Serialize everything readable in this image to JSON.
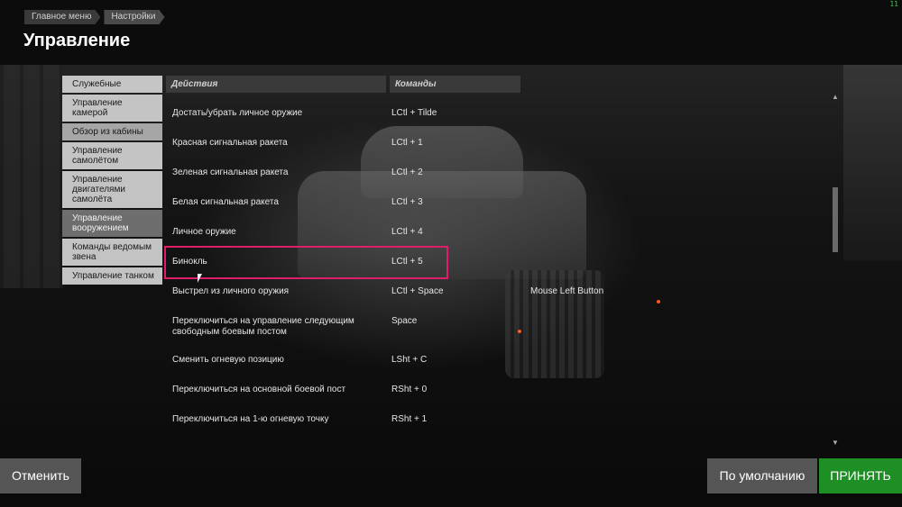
{
  "fps": "11",
  "breadcrumb": [
    "Главное меню",
    "Настройки"
  ],
  "title": "Управление",
  "sidebar": {
    "items": [
      "Служебные",
      "Управление камерой",
      "Обзор из кабины",
      "Управление самолётом",
      "Управление двигателями самолёта",
      "Управление вооружением",
      "Команды ведомым звена",
      "Управление танком"
    ]
  },
  "table": {
    "headers": {
      "actions": "Действия",
      "commands": "Команды"
    },
    "rows": [
      {
        "action": "Достать/убрать личное оружие",
        "cmd": "LCtl + Tilde",
        "cmd2": ""
      },
      {
        "action": "Красная сигнальная ракета",
        "cmd": "LCtl + 1",
        "cmd2": ""
      },
      {
        "action": "Зеленая сигнальная ракета",
        "cmd": "LCtl + 2",
        "cmd2": ""
      },
      {
        "action": "Белая сигнальная ракета",
        "cmd": "LCtl + 3",
        "cmd2": ""
      },
      {
        "action": "Личное оружие",
        "cmd": "LCtl + 4",
        "cmd2": ""
      },
      {
        "action": "Бинокль",
        "cmd": "LCtl + 5",
        "cmd2": ""
      },
      {
        "action": "Выстрел из личного оружия",
        "cmd": "LCtl + Space",
        "cmd2": "Mouse Left Button"
      },
      {
        "action": "Переключиться на управление следующим свободным боевым постом",
        "cmd": "Space",
        "cmd2": ""
      },
      {
        "action": "Сменить огневую позицию",
        "cmd": "LSht + C",
        "cmd2": ""
      },
      {
        "action": "Переключиться на основной боевой пост",
        "cmd": "RSht + 0",
        "cmd2": ""
      },
      {
        "action": "Переключиться на 1-ю огневую точку",
        "cmd": "RSht + 1",
        "cmd2": ""
      }
    ]
  },
  "buttons": {
    "cancel": "Отменить",
    "default": "По умолчанию",
    "accept": "ПРИНЯТЬ"
  },
  "colors": {
    "accent": "#1e8f24",
    "highlight": "#e01c6b"
  }
}
